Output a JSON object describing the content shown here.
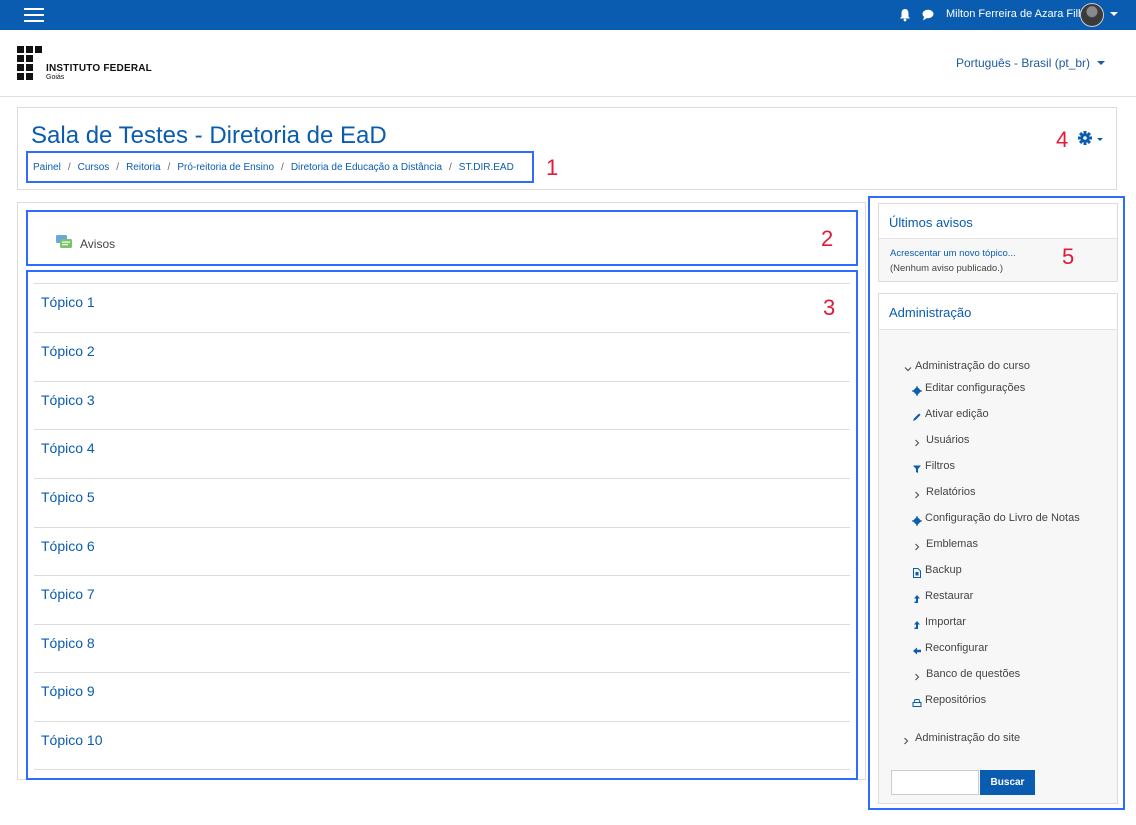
{
  "navbar": {
    "user_name": "Milton Ferreira de Azara Filho",
    "icons": [
      "menu-icon",
      "bell-icon",
      "chat-icon",
      "avatar",
      "chevron-down-icon"
    ]
  },
  "header": {
    "logo_name": "INSTITUTO FEDERAL",
    "logo_sub": "Goiás",
    "language": "Português - Brasil (pt_br)"
  },
  "page": {
    "title": "Sala de Testes - Diretoria de EaD",
    "breadcrumb": [
      "Painel",
      "Cursos",
      "Reitoria",
      "Pró-reitoria de Ensino",
      "Diretoria de Educação a Distância",
      "ST.DIR.EAD"
    ]
  },
  "annotations": [
    "1",
    "2",
    "3",
    "4",
    "5"
  ],
  "main": {
    "avisos_label": "Avisos",
    "topics": [
      "Tópico 1",
      "Tópico 2",
      "Tópico 3",
      "Tópico 4",
      "Tópico 5",
      "Tópico 6",
      "Tópico 7",
      "Tópico 8",
      "Tópico 9",
      "Tópico 10"
    ]
  },
  "news_block": {
    "title": "Últimos avisos",
    "add_link": "Acrescentar um novo tópico...",
    "empty_text": "(Nenhum aviso publicado.)"
  },
  "admin_block": {
    "title": "Administração",
    "course_admin": "Administração do curso",
    "items": [
      {
        "label": "Editar configurações",
        "icon": "gear-icon"
      },
      {
        "label": "Ativar edição",
        "icon": "pencil-icon"
      },
      {
        "label": "Usuários",
        "icon": "chevron-right-icon"
      },
      {
        "label": "Filtros",
        "icon": "filter-icon"
      },
      {
        "label": "Relatórios",
        "icon": "chevron-right-icon"
      },
      {
        "label": "Configuração do Livro de Notas",
        "icon": "gear-icon"
      },
      {
        "label": "Emblemas",
        "icon": "chevron-right-icon"
      },
      {
        "label": "Backup",
        "icon": "file-icon"
      },
      {
        "label": "Restaurar",
        "icon": "upload-icon"
      },
      {
        "label": "Importar",
        "icon": "upload-icon"
      },
      {
        "label": "Reconfigurar",
        "icon": "arrow-left-icon"
      },
      {
        "label": "Banco de questões",
        "icon": "chevron-right-icon"
      },
      {
        "label": "Repositórios",
        "icon": "drive-icon"
      }
    ],
    "site_admin": "Administração do site",
    "search_value": "",
    "search_button": "Buscar"
  },
  "colors": {
    "navbar": "#0a5cb0",
    "link": "#0a5cb0",
    "annotation_box": "#2f6bff",
    "annotation_number": "#e01b3a"
  }
}
